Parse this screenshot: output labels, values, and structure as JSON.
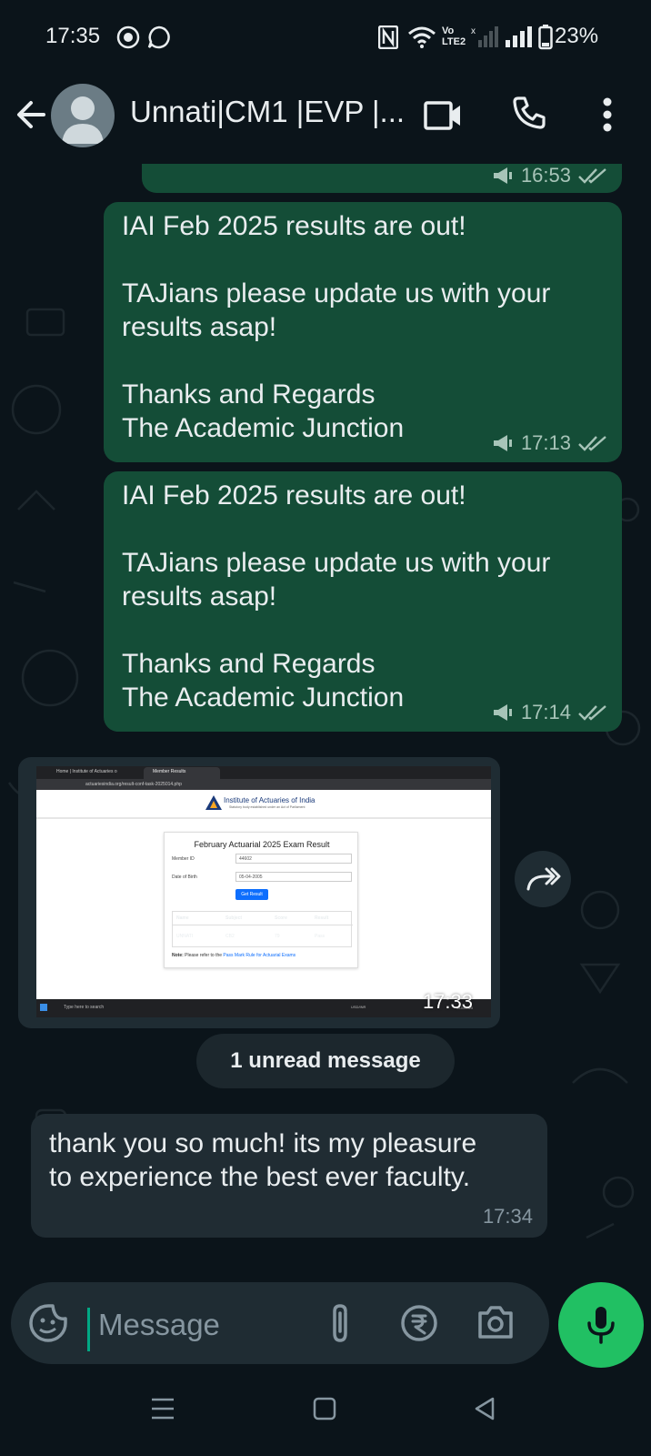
{
  "status_bar": {
    "time": "17:35",
    "battery": "23%",
    "volte": "Vo\nLTE2",
    "icons": [
      "instagram-icon",
      "whatsapp-icon",
      "nfc-icon",
      "wifi-icon",
      "volte-icon",
      "signal-icon",
      "battery-icon"
    ]
  },
  "header": {
    "title": "Unnati|CM1 |EVP |...",
    "icons": [
      "back-arrow-icon",
      "avatar",
      "video-call-icon",
      "voice-call-icon",
      "more-options-icon"
    ]
  },
  "messages": [
    {
      "type": "out",
      "text": "",
      "time": "16:53",
      "broadcast": true,
      "status": "read-double-check"
    },
    {
      "type": "out",
      "text": "IAI Feb 2025 results are out!\n\nTAJians please update us with your results asap!\n\nThanks and Regards\nThe Academic Junction",
      "time": "17:13",
      "broadcast": true
    },
    {
      "type": "out",
      "text": "IAI Feb 2025 results are out!\n\nTAJians please update us with your results asap!\n\nThanks and Regards\nThe Academic Junction",
      "time": "17:14",
      "broadcast": true
    },
    {
      "type": "in-image",
      "time": "17:33",
      "screenshot": {
        "tab1": "Home | Institute of Actuaries o",
        "tab2": "Member Results",
        "url": "actuariesindia.org/result-conf-task-2025014.php",
        "org_name": "Institute of Actuaries of India",
        "org_sub": "Statutory body established under an Act of Parliament",
        "card_title": "February Actuarial 2025 Exam Result",
        "member_id_label": "Member ID",
        "member_id_value": "44602",
        "dob_label": "Date of Birth",
        "dob_value": "05-04-2005",
        "button": "Get Result",
        "table_headers": [
          "Name",
          "Subject",
          "Score",
          "Result"
        ],
        "table_row": [
          "UNNATI",
          "CB2",
          "79",
          "Pass"
        ],
        "note_bold": "Note:",
        "note_text": "Please refer to the",
        "note_link": "Pass Mark Rule for Actuarial Exams",
        "taskbar_search": "Type here to search",
        "taskbar_status": "USD/INR",
        "taskbar_time": "19-04-2025"
      }
    },
    {
      "type": "unread",
      "text": "1 unread message"
    },
    {
      "type": "in",
      "text": "thank you so much! its my pleasure\nto experience the best ever faculty.",
      "time": "17:34"
    }
  ],
  "input": {
    "placeholder": "Message",
    "icons": [
      "sticker-icon",
      "attach-icon",
      "rupee-payment-icon",
      "camera-icon",
      "mic-icon"
    ]
  },
  "navbar": {
    "icons": [
      "recents-icon",
      "home-icon",
      "back-icon"
    ]
  },
  "colors": {
    "background": "#0b141a",
    "outgoing_bubble": "#144d37",
    "incoming_bubble": "#202c33",
    "accent_green": "#21c063"
  }
}
